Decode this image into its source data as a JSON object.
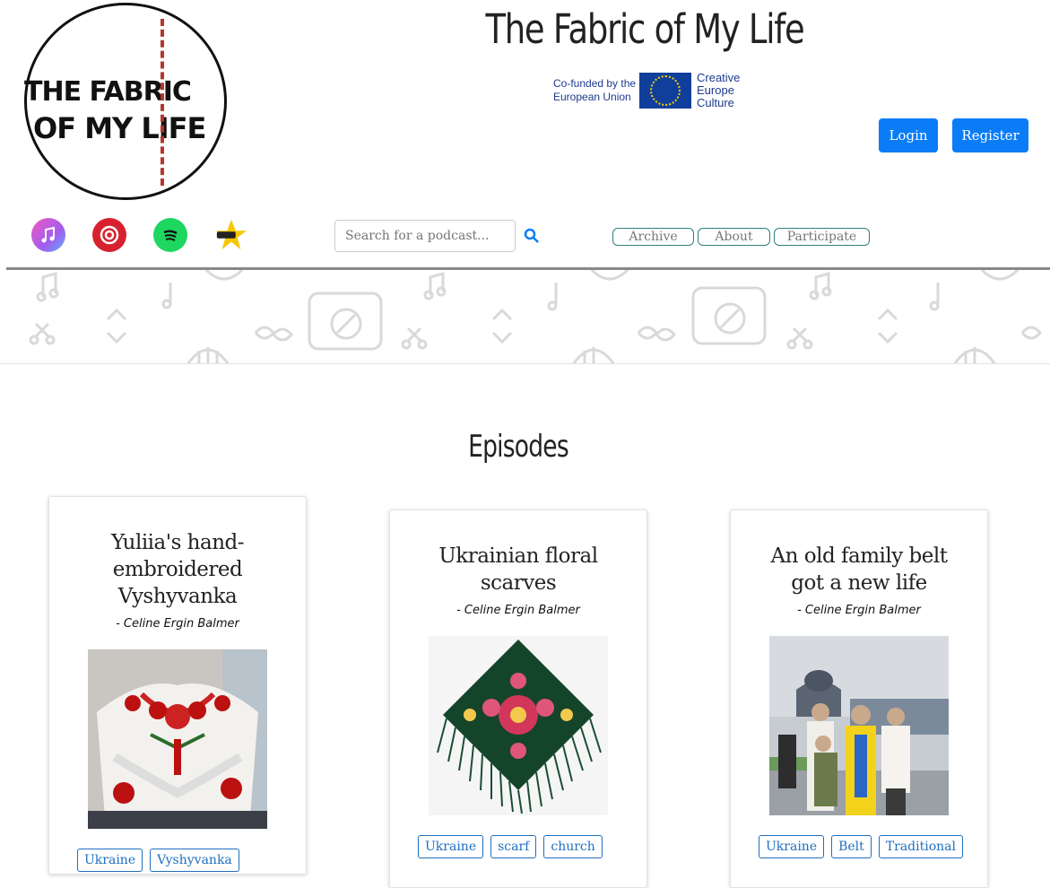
{
  "header": {
    "logo": {
      "line1": "THE FABRIC",
      "line2": "OF MY LIFE"
    },
    "site_title": "The Fabric of My Life",
    "eu_badge": {
      "cofunded": "Co-funded by the European Union",
      "program": "Creative Europe Culture"
    },
    "login_label": "Login",
    "register_label": "Register"
  },
  "nav": {
    "podcast_platforms": [
      "apple-podcasts-icon",
      "castbox-icon",
      "spotify-icon",
      "podcast-star-icon"
    ],
    "search": {
      "placeholder": "Search for a podcast..."
    },
    "links": {
      "archive": "Archive",
      "about": "About",
      "participate": "Participate"
    }
  },
  "main": {
    "section_title": "Episodes",
    "episodes": [
      {
        "title": "Yuliia's hand-embroidered Vyshyvanka",
        "author": "- Celine Ergin Balmer",
        "image": "embroidered-blouse-image",
        "tags": [
          "Ukraine",
          "Vyshyvanka"
        ]
      },
      {
        "title": "Ukrainian floral scarves",
        "author": "- Celine Ergin Balmer",
        "image": "floral-scarf-image",
        "tags": [
          "Ukraine",
          "scarf",
          "church"
        ]
      },
      {
        "title": "An old family belt got a new life",
        "author": "- Celine Ergin Balmer",
        "image": "family-photo-image",
        "tags": [
          "Ukraine",
          "Belt",
          "Traditional"
        ]
      }
    ]
  },
  "colors": {
    "primary": "#0a7cf5",
    "accent_red": "#b5362c",
    "tag_blue": "#1e6fc0",
    "nav_border": "#2f7f7f"
  }
}
